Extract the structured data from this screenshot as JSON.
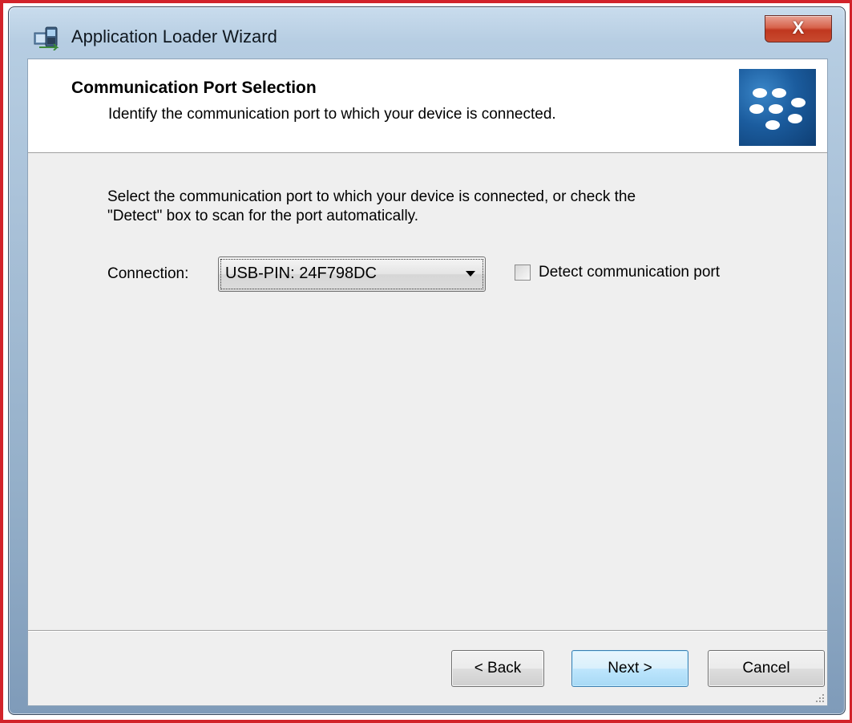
{
  "window": {
    "title": "Application Loader Wizard",
    "close_glyph": "X",
    "app_icon": "application-loader-icon"
  },
  "header": {
    "title": "Communication Port Selection",
    "subtitle": "Identify the communication port to which your device is connected.",
    "logo": "blackberry-logo"
  },
  "main": {
    "instructions_line1": "Select the communication port to which your device is connected, or check the",
    "instructions_line2": "\"Detect\" box to scan for the port automatically.",
    "connection_label": "Connection:",
    "connection_value": "USB-PIN: 24F798DC",
    "detect_checkbox": {
      "label": "Detect communication port",
      "checked": false
    }
  },
  "footer": {
    "back_label": "< Back",
    "next_label": "Next >",
    "cancel_label": "Cancel"
  },
  "colors": {
    "frame_highlight": "#d2232a",
    "close_button": "#c84a2f",
    "dialog_background": "#efefef",
    "logo_blue": "#1b5c9e"
  }
}
